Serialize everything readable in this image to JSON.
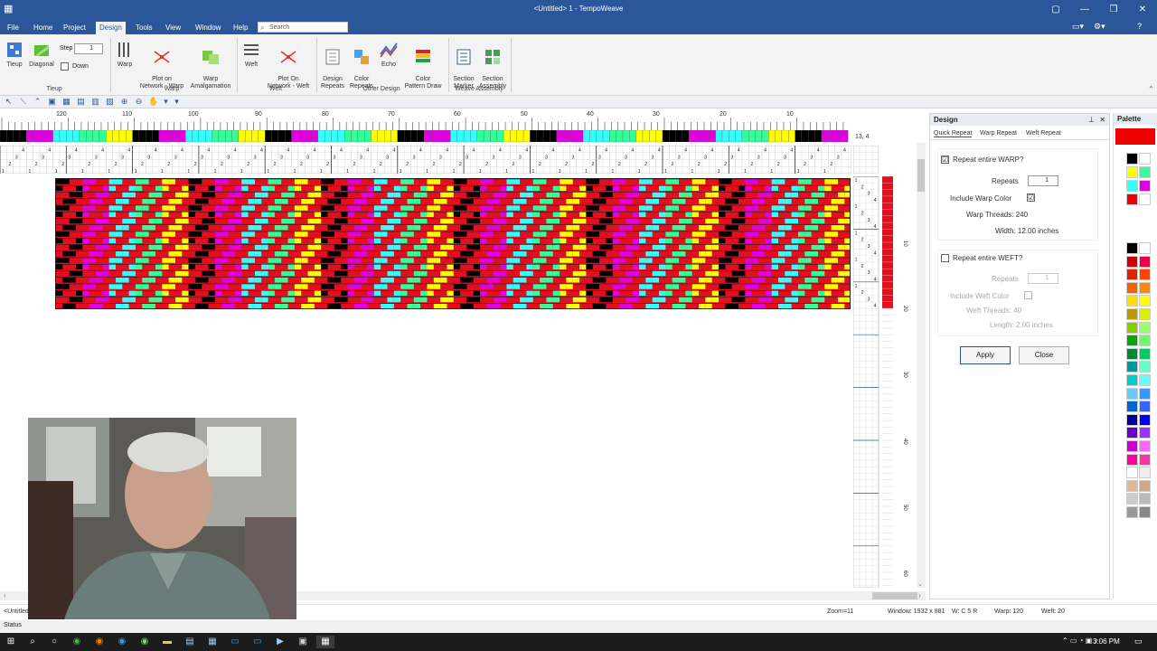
{
  "window": {
    "title": "<Untitled> 1 - TempoWeave"
  },
  "menu": {
    "items": [
      "File",
      "Home",
      "Project",
      "Design",
      "Tools",
      "View",
      "Window",
      "Help"
    ],
    "active": "Design",
    "search_placeholder": "Search"
  },
  "ribbon": {
    "tieup": {
      "tieup_label": "Tieup",
      "diagonal_label": "Diagonal",
      "step_label": "Step",
      "step_value": "1",
      "down_label": "Down",
      "group": "Tieup"
    },
    "warp": {
      "warp_label": "Warp",
      "plot_label": "Plot on\nNetwork - Warp",
      "amalg_label": "Warp\nAmalgamation",
      "group": "Warp"
    },
    "weft": {
      "weft_label": "Weft",
      "plot_label": "Plot On\nNetwork - Weft",
      "group": "Weft"
    },
    "other": {
      "design_repeats": "Design\nRepeats",
      "color_repeats": "Color\nRepeats",
      "echo": "Echo",
      "color_pattern_draw": "Color\nPattern Draw",
      "group": "Other Design"
    },
    "assembly": {
      "section_marker": "Section\nMarker",
      "section_assembly": "Section\nAssembly",
      "group": "Weave Assembly"
    }
  },
  "ruler": {
    "labels": [
      "120",
      "110",
      "100",
      "90",
      "80",
      "70",
      "60",
      "50",
      "40",
      "30",
      "20",
      "10"
    ],
    "coord": "13, 4"
  },
  "right_ruler": {
    "labels": [
      "10",
      "20",
      "30",
      "40",
      "50",
      "60"
    ]
  },
  "colors": {
    "strip": [
      "#000000",
      "#e000e0",
      "#33ffff",
      "#33ff99",
      "#ffff00",
      "#000000",
      "#e000e0",
      "#33ffff",
      "#33ff99",
      "#ffff00"
    ],
    "pattern_red": "#e01020",
    "palette_top": "#ee0000"
  },
  "design_panel": {
    "title": "Design",
    "tabs": [
      "Quick Repeat",
      "Warp Repeat",
      "Weft Repeat"
    ],
    "warp": {
      "repeat_label": "Repeat entire WARP?",
      "repeat_checked": "☑",
      "repeats_label": "Repeats",
      "repeats_value": "1",
      "include_color_label": "Include Warp Color",
      "include_color_checked": "☑",
      "threads": "Warp Threads: 240",
      "width": "Width: 12.00 inches"
    },
    "weft": {
      "repeat_label": "Repeat entire WEFT?",
      "repeats_label": "Repeats",
      "repeats_value": "1",
      "include_color_label": "Include Weft Color",
      "threads": "Weft Threads: 40",
      "length": "Length: 2.00 inches"
    },
    "apply_label": "Apply",
    "close_label": "Close"
  },
  "palette": {
    "title": "Palette",
    "swatches": [
      "#000000",
      "#ffffff",
      "#ffff00",
      "#33ff99",
      "#33ffff",
      "#e000e0",
      "#ee0000",
      "#ffffff",
      "#000000",
      "#ffffff",
      "#cc0000",
      "#ee0044",
      "#dd2200",
      "#ff4400",
      "#ee6600",
      "#ff8800",
      "#ffdd00",
      "#ffff00",
      "#bb9900",
      "#ddee00",
      "#88cc00",
      "#99ff66",
      "#00aa00",
      "#66ff66",
      "#008833",
      "#00cc66",
      "#009999",
      "#66ffcc",
      "#00cccc",
      "#66ffff",
      "#66ccff",
      "#3399ff",
      "#0066cc",
      "#3366ff",
      "#000099",
      "#0000ff",
      "#6600cc",
      "#9933ff",
      "#cc00cc",
      "#ff66ff",
      "#ff0099",
      "#ff3399",
      "#ffffff",
      "#eeeeee",
      "#ddbb99",
      "#ccaa88",
      "#cccccc",
      "#bbbbbb",
      "#999999",
      "#888888"
    ]
  },
  "status": {
    "tab": "<Untitled",
    "zoom": "Zoom=11",
    "window": "Window: 1932 x 881",
    "wcode": "W: C 5 R",
    "warp": "Warp: 120",
    "weft": "Weft: 20",
    "bar": "Status",
    "clock": "3:06 PM"
  }
}
